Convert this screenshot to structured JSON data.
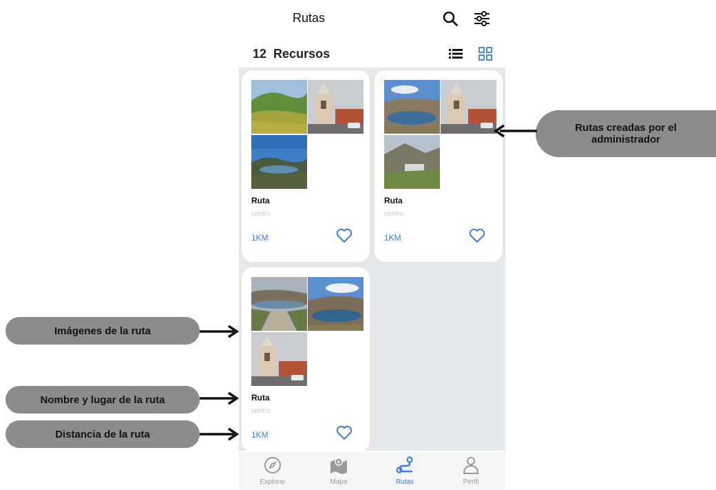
{
  "header": {
    "title": "Rutas"
  },
  "toolbar": {
    "count": "12",
    "count_label": "Recursos"
  },
  "cards": [
    {
      "title": "Ruta",
      "subtitle": "centro",
      "distance": "1KM"
    },
    {
      "title": "Ruta",
      "subtitle": "centro",
      "distance": "1KM"
    },
    {
      "title": "Ruta",
      "subtitle": "centro",
      "distance": "1KM"
    }
  ],
  "bottom_nav": [
    {
      "label": "Explorar",
      "icon": "compass-icon",
      "active": false
    },
    {
      "label": "Mapa",
      "icon": "map-icon",
      "active": false
    },
    {
      "label": "Rutas",
      "icon": "route-icon",
      "active": true
    },
    {
      "label": "Perfil",
      "icon": "person-icon",
      "active": false
    }
  ],
  "annotations": {
    "images": "Imágenes de la ruta",
    "name_place": "Nombre y lugar de la ruta",
    "distance": "Distancia de la ruta",
    "admin_line1": "Rutas creadas por el",
    "admin_line2": "administrador"
  },
  "colors": {
    "accent": "#3b7de0",
    "callout": "#8c8c8c",
    "grid_bg": "#e5e8ea"
  }
}
